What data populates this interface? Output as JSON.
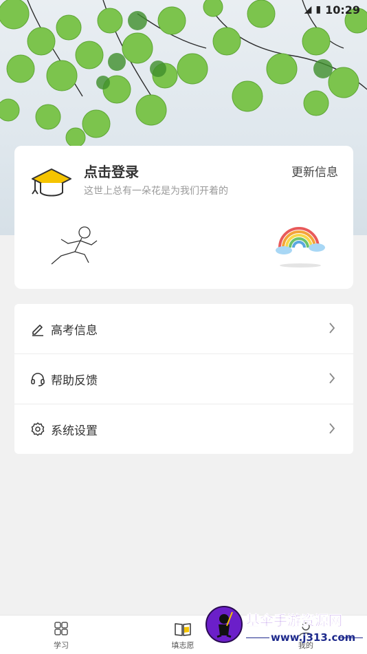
{
  "status_bar": {
    "time": "10:29"
  },
  "profile": {
    "title": "点击登录",
    "subtitle": "这世上总有一朵花是为我们开着的",
    "update_label": "更新信息"
  },
  "menu": {
    "items": [
      {
        "label": "高考信息",
        "icon": "pencil-icon"
      },
      {
        "label": "帮助反馈",
        "icon": "headset-icon"
      },
      {
        "label": "系统设置",
        "icon": "gear-icon"
      }
    ]
  },
  "bottom_nav": {
    "items": [
      {
        "label": "学习",
        "icon": "grid-icon"
      },
      {
        "label": "填志愿",
        "icon": "book-icon"
      },
      {
        "label": "我的",
        "icon": "person-icon"
      }
    ]
  },
  "watermark": {
    "title": "基伞手游资源网",
    "url": "www.j313.com"
  },
  "colors": {
    "accent": "#f5c400",
    "background": "#f1f1f1",
    "card": "#ffffff"
  }
}
